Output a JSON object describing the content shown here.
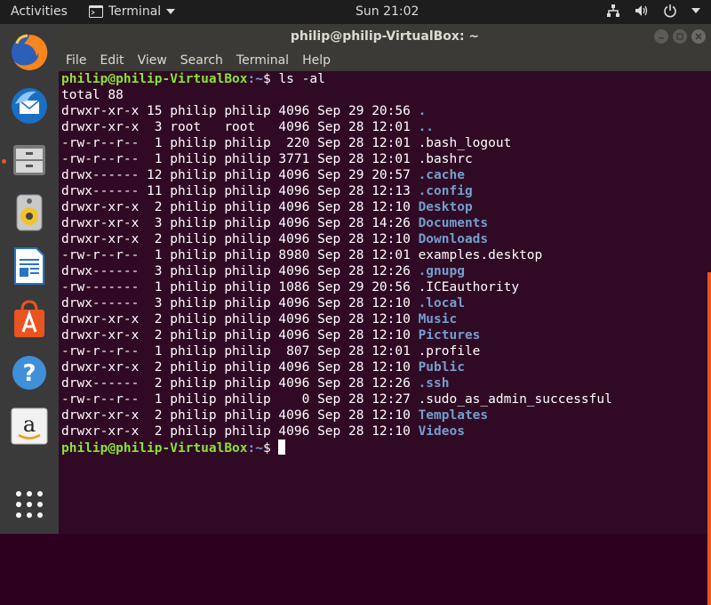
{
  "topbar": {
    "activities": "Activities",
    "app_name": "Terminal",
    "clock": "Sun 21:02"
  },
  "window": {
    "title": "philip@philip-VirtualBox: ~"
  },
  "menu": [
    "File",
    "Edit",
    "View",
    "Search",
    "Terminal",
    "Help"
  ],
  "terminal": {
    "prompt_user": "philip@philip-VirtualBox",
    "prompt_path": ":~",
    "prompt_symbol": "$ ",
    "command": "ls -al",
    "total": "total 88",
    "entries": [
      {
        "meta": "drwxr-xr-x 15 philip philip 4096 Sep 29 20:56 ",
        "name": ".",
        "dir": true
      },
      {
        "meta": "drwxr-xr-x  3 root   root   4096 Sep 28 12:01 ",
        "name": "..",
        "dir": true
      },
      {
        "meta": "-rw-r--r--  1 philip philip  220 Sep 28 12:01 ",
        "name": ".bash_logout",
        "dir": false
      },
      {
        "meta": "-rw-r--r--  1 philip philip 3771 Sep 28 12:01 ",
        "name": ".bashrc",
        "dir": false
      },
      {
        "meta": "drwx------ 12 philip philip 4096 Sep 29 20:57 ",
        "name": ".cache",
        "dir": true
      },
      {
        "meta": "drwx------ 11 philip philip 4096 Sep 28 12:13 ",
        "name": ".config",
        "dir": true
      },
      {
        "meta": "drwxr-xr-x  2 philip philip 4096 Sep 28 12:10 ",
        "name": "Desktop",
        "dir": true
      },
      {
        "meta": "drwxr-xr-x  3 philip philip 4096 Sep 28 14:26 ",
        "name": "Documents",
        "dir": true
      },
      {
        "meta": "drwxr-xr-x  2 philip philip 4096 Sep 28 12:10 ",
        "name": "Downloads",
        "dir": true
      },
      {
        "meta": "-rw-r--r--  1 philip philip 8980 Sep 28 12:01 ",
        "name": "examples.desktop",
        "dir": false
      },
      {
        "meta": "drwx------  3 philip philip 4096 Sep 28 12:26 ",
        "name": ".gnupg",
        "dir": true
      },
      {
        "meta": "-rw-------  1 philip philip 1086 Sep 29 20:56 ",
        "name": ".ICEauthority",
        "dir": false
      },
      {
        "meta": "drwx------  3 philip philip 4096 Sep 28 12:10 ",
        "name": ".local",
        "dir": true
      },
      {
        "meta": "drwxr-xr-x  2 philip philip 4096 Sep 28 12:10 ",
        "name": "Music",
        "dir": true
      },
      {
        "meta": "drwxr-xr-x  2 philip philip 4096 Sep 28 12:10 ",
        "name": "Pictures",
        "dir": true
      },
      {
        "meta": "-rw-r--r--  1 philip philip  807 Sep 28 12:01 ",
        "name": ".profile",
        "dir": false
      },
      {
        "meta": "drwxr-xr-x  2 philip philip 4096 Sep 28 12:10 ",
        "name": "Public",
        "dir": true
      },
      {
        "meta": "drwx------  2 philip philip 4096 Sep 28 12:26 ",
        "name": ".ssh",
        "dir": true
      },
      {
        "meta": "-rw-r--r--  1 philip philip    0 Sep 28 12:27 ",
        "name": ".sudo_as_admin_successful",
        "dir": false
      },
      {
        "meta": "drwxr-xr-x  2 philip philip 4096 Sep 28 12:10 ",
        "name": "Templates",
        "dir": true
      },
      {
        "meta": "drwxr-xr-x  2 philip philip 4096 Sep 28 12:10 ",
        "name": "Videos",
        "dir": true
      }
    ]
  },
  "dock": [
    {
      "name": "firefox-icon"
    },
    {
      "name": "thunderbird-icon"
    },
    {
      "name": "files-icon"
    },
    {
      "name": "rhythmbox-icon"
    },
    {
      "name": "writer-icon"
    },
    {
      "name": "software-center-icon"
    },
    {
      "name": "help-icon"
    },
    {
      "name": "amazon-icon"
    },
    {
      "name": "show-apps-icon"
    }
  ],
  "colors": {
    "terminal_bg": "#300a24",
    "prompt_user": "#8ae234",
    "prompt_path": "#729fcf",
    "directory": "#729fcf",
    "accent": "#e95420"
  }
}
